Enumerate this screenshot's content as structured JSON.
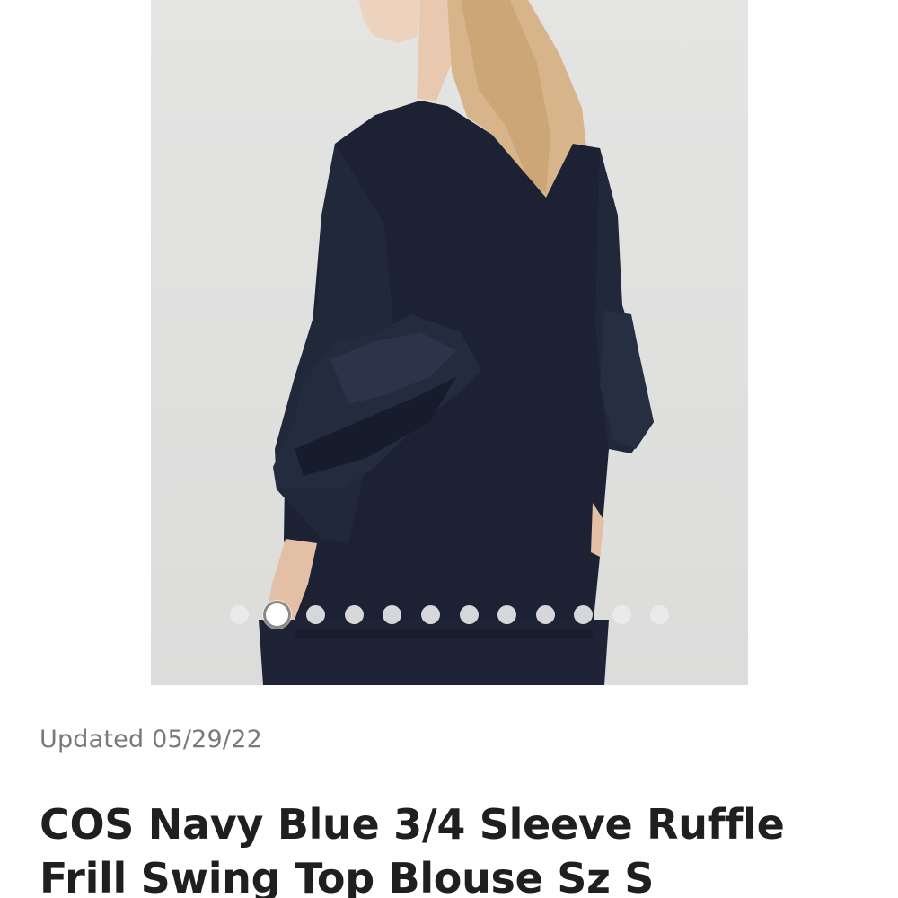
{
  "listing": {
    "updated_text": "Updated 05/29/22",
    "title": "COS Navy Blue 3/4 Sleeve Ruffle Frill Swing Top Blouse Sz S"
  },
  "carousel": {
    "image_count": 12,
    "active_index": 1
  },
  "colors": {
    "garment": "#1c2233",
    "background": "#e2e2e1",
    "title_text": "#1f1f1f",
    "meta_text": "#7a7a7a"
  }
}
